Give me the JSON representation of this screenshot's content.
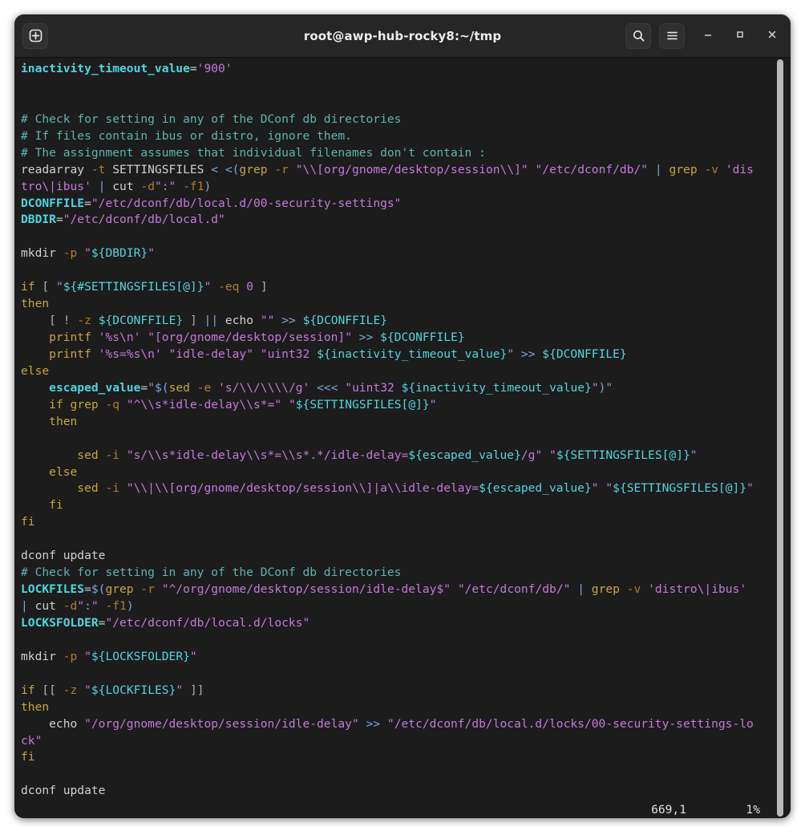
{
  "window": {
    "title": "root@awp-hub-rocky8:~/tmp",
    "titlebar": {
      "new_tab_label": "+",
      "search_label": "search",
      "menu_label": "menu",
      "minimize_label": "–",
      "maximize_label": "□",
      "close_label": "✕"
    }
  },
  "colors": {
    "window_bg": "#1c1c1c",
    "titlebar_bg": "#262626",
    "comment": "#5fb3b3",
    "variable": "#4fd6e0",
    "string": "#c678dd",
    "keyword": "#c8a63c",
    "option": "#b07d2b",
    "operator": "#7aa6da",
    "scrollbar_thumb": "#b9b9b9"
  },
  "statusbar": {
    "position": "669,1",
    "percent": "1%"
  },
  "terminal": {
    "lines": [
      [
        {
          "t": "inactivity_timeout_value",
          "c": "c-var"
        },
        {
          "t": "=",
          "c": "c-def"
        },
        {
          "t": "'900'",
          "c": "c-str"
        }
      ],
      [],
      [],
      [
        {
          "t": "# Check for setting in any of the DConf db directories",
          "c": "c-com"
        }
      ],
      [
        {
          "t": "# If files contain ibus or distro, ignore them.",
          "c": "c-com"
        }
      ],
      [
        {
          "t": "# The assignment assumes that individual filenames don't contain :",
          "c": "c-com"
        }
      ],
      [
        {
          "t": "readarray ",
          "c": "c-def"
        },
        {
          "t": "-t",
          "c": "c-opt"
        },
        {
          "t": " SETTINGSFILES ",
          "c": "c-def"
        },
        {
          "t": "<",
          "c": "c-op"
        },
        {
          "t": " ",
          "c": "c-def"
        },
        {
          "t": "<(",
          "c": "c-op"
        },
        {
          "t": "grep",
          "c": "c-cmd"
        },
        {
          "t": " ",
          "c": "c-def"
        },
        {
          "t": "-r",
          "c": "c-opt"
        },
        {
          "t": " ",
          "c": "c-def"
        },
        {
          "t": "\"\\\\[org/gnome/desktop/session\\\\]\"",
          "c": "c-str"
        },
        {
          "t": " ",
          "c": "c-def"
        },
        {
          "t": "\"/etc/dconf/db/\"",
          "c": "c-str"
        },
        {
          "t": " ",
          "c": "c-def"
        },
        {
          "t": "|",
          "c": "c-op"
        },
        {
          "t": " ",
          "c": "c-def"
        },
        {
          "t": "grep",
          "c": "c-cmd"
        },
        {
          "t": " ",
          "c": "c-def"
        },
        {
          "t": "-v",
          "c": "c-opt"
        },
        {
          "t": " ",
          "c": "c-def"
        },
        {
          "t": "'dis",
          "c": "c-str"
        }
      ],
      [
        {
          "t": "tro\\|ibus'",
          "c": "c-str"
        },
        {
          "t": " ",
          "c": "c-def"
        },
        {
          "t": "|",
          "c": "c-op"
        },
        {
          "t": " cut ",
          "c": "c-def"
        },
        {
          "t": "-d",
          "c": "c-opt"
        },
        {
          "t": "\":\"",
          "c": "c-str"
        },
        {
          "t": " ",
          "c": "c-def"
        },
        {
          "t": "-f1",
          "c": "c-opt"
        },
        {
          "t": ")",
          "c": "c-op"
        }
      ],
      [
        {
          "t": "DCONFFILE",
          "c": "c-var"
        },
        {
          "t": "=",
          "c": "c-def"
        },
        {
          "t": "\"/etc/dconf/db/local.d/00-security-settings\"",
          "c": "c-str"
        }
      ],
      [
        {
          "t": "DBDIR",
          "c": "c-var"
        },
        {
          "t": "=",
          "c": "c-def"
        },
        {
          "t": "\"/etc/dconf/db/local.d\"",
          "c": "c-str"
        }
      ],
      [],
      [
        {
          "t": "mkdir ",
          "c": "c-def"
        },
        {
          "t": "-p",
          "c": "c-opt"
        },
        {
          "t": " ",
          "c": "c-def"
        },
        {
          "t": "\"",
          "c": "c-str"
        },
        {
          "t": "${DBDIR}",
          "c": "c-varref"
        },
        {
          "t": "\"",
          "c": "c-str"
        }
      ],
      [],
      [
        {
          "t": "if",
          "c": "c-kw"
        },
        {
          "t": " ",
          "c": "c-def"
        },
        {
          "t": "[",
          "c": "c-punct"
        },
        {
          "t": " ",
          "c": "c-def"
        },
        {
          "t": "\"",
          "c": "c-str"
        },
        {
          "t": "${#SETTINGSFILES[@]}",
          "c": "c-varref"
        },
        {
          "t": "\"",
          "c": "c-str"
        },
        {
          "t": " ",
          "c": "c-def"
        },
        {
          "t": "-eq",
          "c": "c-opt"
        },
        {
          "t": " ",
          "c": "c-def"
        },
        {
          "t": "0",
          "c": "c-num"
        },
        {
          "t": " ",
          "c": "c-def"
        },
        {
          "t": "]",
          "c": "c-punct"
        }
      ],
      [
        {
          "t": "then",
          "c": "c-kw"
        }
      ],
      [
        {
          "t": "    ",
          "c": "c-def"
        },
        {
          "t": "[",
          "c": "c-punct"
        },
        {
          "t": " ",
          "c": "c-def"
        },
        {
          "t": "!",
          "c": "c-punct"
        },
        {
          "t": " ",
          "c": "c-def"
        },
        {
          "t": "-z",
          "c": "c-opt"
        },
        {
          "t": " ",
          "c": "c-def"
        },
        {
          "t": "${DCONFFILE}",
          "c": "c-varref"
        },
        {
          "t": " ",
          "c": "c-def"
        },
        {
          "t": "]",
          "c": "c-punct"
        },
        {
          "t": " ",
          "c": "c-def"
        },
        {
          "t": "||",
          "c": "c-op"
        },
        {
          "t": " echo ",
          "c": "c-def"
        },
        {
          "t": "\"\"",
          "c": "c-str"
        },
        {
          "t": " ",
          "c": "c-def"
        },
        {
          "t": ">>",
          "c": "c-op"
        },
        {
          "t": " ",
          "c": "c-def"
        },
        {
          "t": "${DCONFFILE}",
          "c": "c-varref"
        }
      ],
      [
        {
          "t": "    ",
          "c": "c-def"
        },
        {
          "t": "printf",
          "c": "c-cmd"
        },
        {
          "t": " ",
          "c": "c-def"
        },
        {
          "t": "'%s\\n'",
          "c": "c-str"
        },
        {
          "t": " ",
          "c": "c-def"
        },
        {
          "t": "\"[org/gnome/desktop/session]\"",
          "c": "c-str"
        },
        {
          "t": " ",
          "c": "c-def"
        },
        {
          "t": ">>",
          "c": "c-op"
        },
        {
          "t": " ",
          "c": "c-def"
        },
        {
          "t": "${DCONFFILE}",
          "c": "c-varref"
        }
      ],
      [
        {
          "t": "    ",
          "c": "c-def"
        },
        {
          "t": "printf",
          "c": "c-cmd"
        },
        {
          "t": " ",
          "c": "c-def"
        },
        {
          "t": "'%s=%s\\n'",
          "c": "c-str"
        },
        {
          "t": " ",
          "c": "c-def"
        },
        {
          "t": "\"idle-delay\"",
          "c": "c-str"
        },
        {
          "t": " ",
          "c": "c-def"
        },
        {
          "t": "\"uint32 ",
          "c": "c-str"
        },
        {
          "t": "${inactivity_timeout_value}",
          "c": "c-varref"
        },
        {
          "t": "\"",
          "c": "c-str"
        },
        {
          "t": " ",
          "c": "c-def"
        },
        {
          "t": ">>",
          "c": "c-op"
        },
        {
          "t": " ",
          "c": "c-def"
        },
        {
          "t": "${DCONFFILE}",
          "c": "c-varref"
        }
      ],
      [
        {
          "t": "else",
          "c": "c-kw"
        }
      ],
      [
        {
          "t": "    ",
          "c": "c-def"
        },
        {
          "t": "escaped_value",
          "c": "c-var"
        },
        {
          "t": "=",
          "c": "c-def"
        },
        {
          "t": "\"",
          "c": "c-str"
        },
        {
          "t": "$(",
          "c": "c-op"
        },
        {
          "t": "sed",
          "c": "c-cmd"
        },
        {
          "t": " ",
          "c": "c-def"
        },
        {
          "t": "-e",
          "c": "c-opt"
        },
        {
          "t": " ",
          "c": "c-def"
        },
        {
          "t": "'s/\\\\/\\\\\\\\/g'",
          "c": "c-str"
        },
        {
          "t": " ",
          "c": "c-def"
        },
        {
          "t": "<<<",
          "c": "c-op"
        },
        {
          "t": " ",
          "c": "c-def"
        },
        {
          "t": "\"uint32 ",
          "c": "c-str"
        },
        {
          "t": "${inactivity_timeout_value}",
          "c": "c-varref"
        },
        {
          "t": "\"",
          "c": "c-str"
        },
        {
          "t": ")",
          "c": "c-op"
        },
        {
          "t": "\"",
          "c": "c-str"
        }
      ],
      [
        {
          "t": "    ",
          "c": "c-def"
        },
        {
          "t": "if",
          "c": "c-kw"
        },
        {
          "t": " ",
          "c": "c-def"
        },
        {
          "t": "grep",
          "c": "c-cmd"
        },
        {
          "t": " ",
          "c": "c-def"
        },
        {
          "t": "-q",
          "c": "c-opt"
        },
        {
          "t": " ",
          "c": "c-def"
        },
        {
          "t": "\"^\\\\s*idle-delay\\\\s*=\"",
          "c": "c-str"
        },
        {
          "t": " ",
          "c": "c-def"
        },
        {
          "t": "\"",
          "c": "c-str"
        },
        {
          "t": "${SETTINGSFILES[@]}",
          "c": "c-varref"
        },
        {
          "t": "\"",
          "c": "c-str"
        }
      ],
      [
        {
          "t": "    ",
          "c": "c-def"
        },
        {
          "t": "then",
          "c": "c-kw"
        }
      ],
      [],
      [
        {
          "t": "        ",
          "c": "c-def"
        },
        {
          "t": "sed",
          "c": "c-cmd"
        },
        {
          "t": " ",
          "c": "c-def"
        },
        {
          "t": "-i",
          "c": "c-opt"
        },
        {
          "t": " ",
          "c": "c-def"
        },
        {
          "t": "\"s/\\\\s*idle-delay\\\\s*=\\\\s*.*/idle-delay=",
          "c": "c-str"
        },
        {
          "t": "${escaped_value}",
          "c": "c-varref"
        },
        {
          "t": "/g\"",
          "c": "c-str"
        },
        {
          "t": " ",
          "c": "c-def"
        },
        {
          "t": "\"",
          "c": "c-str"
        },
        {
          "t": "${SETTINGSFILES[@]}",
          "c": "c-varref"
        },
        {
          "t": "\"",
          "c": "c-str"
        }
      ],
      [
        {
          "t": "    ",
          "c": "c-def"
        },
        {
          "t": "else",
          "c": "c-kw"
        }
      ],
      [
        {
          "t": "        ",
          "c": "c-def"
        },
        {
          "t": "sed",
          "c": "c-cmd"
        },
        {
          "t": " ",
          "c": "c-def"
        },
        {
          "t": "-i",
          "c": "c-opt"
        },
        {
          "t": " ",
          "c": "c-def"
        },
        {
          "t": "\"\\\\|\\\\[org/gnome/desktop/session\\\\]|a\\\\idle-delay=",
          "c": "c-str"
        },
        {
          "t": "${escaped_value}",
          "c": "c-varref"
        },
        {
          "t": "\"",
          "c": "c-str"
        },
        {
          "t": " ",
          "c": "c-def"
        },
        {
          "t": "\"",
          "c": "c-str"
        },
        {
          "t": "${SETTINGSFILES[@]}",
          "c": "c-varref"
        },
        {
          "t": "\"",
          "c": "c-str"
        }
      ],
      [
        {
          "t": "    ",
          "c": "c-def"
        },
        {
          "t": "fi",
          "c": "c-kw"
        }
      ],
      [
        {
          "t": "fi",
          "c": "c-kw"
        }
      ],
      [],
      [
        {
          "t": "dconf update",
          "c": "c-def"
        }
      ],
      [
        {
          "t": "# Check for setting in any of the DConf db directories",
          "c": "c-com"
        }
      ],
      [
        {
          "t": "LOCKFILES",
          "c": "c-var"
        },
        {
          "t": "=",
          "c": "c-def"
        },
        {
          "t": "$(",
          "c": "c-op"
        },
        {
          "t": "grep",
          "c": "c-cmd"
        },
        {
          "t": " ",
          "c": "c-def"
        },
        {
          "t": "-r",
          "c": "c-opt"
        },
        {
          "t": " ",
          "c": "c-def"
        },
        {
          "t": "\"^/org/gnome/desktop/session/idle-delay$\"",
          "c": "c-str"
        },
        {
          "t": " ",
          "c": "c-def"
        },
        {
          "t": "\"/etc/dconf/db/\"",
          "c": "c-str"
        },
        {
          "t": " ",
          "c": "c-def"
        },
        {
          "t": "|",
          "c": "c-op"
        },
        {
          "t": " ",
          "c": "c-def"
        },
        {
          "t": "grep",
          "c": "c-cmd"
        },
        {
          "t": " ",
          "c": "c-def"
        },
        {
          "t": "-v",
          "c": "c-opt"
        },
        {
          "t": " ",
          "c": "c-def"
        },
        {
          "t": "'distro\\|ibus'",
          "c": "c-str"
        }
      ],
      [
        {
          "t": "|",
          "c": "c-op"
        },
        {
          "t": " cut ",
          "c": "c-def"
        },
        {
          "t": "-d",
          "c": "c-opt"
        },
        {
          "t": "\":\"",
          "c": "c-str"
        },
        {
          "t": " ",
          "c": "c-def"
        },
        {
          "t": "-f1",
          "c": "c-opt"
        },
        {
          "t": ")",
          "c": "c-op"
        }
      ],
      [
        {
          "t": "LOCKSFOLDER",
          "c": "c-var"
        },
        {
          "t": "=",
          "c": "c-def"
        },
        {
          "t": "\"/etc/dconf/db/local.d/locks\"",
          "c": "c-str"
        }
      ],
      [],
      [
        {
          "t": "mkdir ",
          "c": "c-def"
        },
        {
          "t": "-p",
          "c": "c-opt"
        },
        {
          "t": " ",
          "c": "c-def"
        },
        {
          "t": "\"",
          "c": "c-str"
        },
        {
          "t": "${LOCKSFOLDER}",
          "c": "c-varref"
        },
        {
          "t": "\"",
          "c": "c-str"
        }
      ],
      [],
      [
        {
          "t": "if",
          "c": "c-kw"
        },
        {
          "t": " ",
          "c": "c-def"
        },
        {
          "t": "[[",
          "c": "c-punct"
        },
        {
          "t": " ",
          "c": "c-def"
        },
        {
          "t": "-z",
          "c": "c-opt"
        },
        {
          "t": " ",
          "c": "c-def"
        },
        {
          "t": "\"",
          "c": "c-str"
        },
        {
          "t": "${LOCKFILES}",
          "c": "c-varref"
        },
        {
          "t": "\"",
          "c": "c-str"
        },
        {
          "t": " ",
          "c": "c-def"
        },
        {
          "t": "]]",
          "c": "c-punct"
        }
      ],
      [
        {
          "t": "then",
          "c": "c-kw"
        }
      ],
      [
        {
          "t": "    echo ",
          "c": "c-def"
        },
        {
          "t": "\"/org/gnome/desktop/session/idle-delay\"",
          "c": "c-str"
        },
        {
          "t": " ",
          "c": "c-def"
        },
        {
          "t": ">>",
          "c": "c-op"
        },
        {
          "t": " ",
          "c": "c-def"
        },
        {
          "t": "\"/etc/dconf/db/local.d/locks/00-security-settings-lo",
          "c": "c-str"
        }
      ],
      [
        {
          "t": "ck\"",
          "c": "c-str"
        }
      ],
      [
        {
          "t": "fi",
          "c": "c-kw"
        }
      ],
      [],
      [
        {
          "t": "dconf update",
          "c": "c-def"
        }
      ]
    ]
  }
}
